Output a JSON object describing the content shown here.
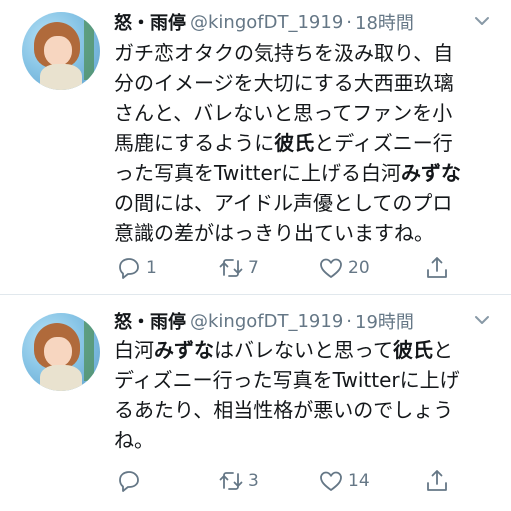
{
  "tweets": [
    {
      "name": "怒・雨停",
      "handle": "@kingofDT_1919",
      "separator": "·",
      "time": "18時間",
      "lines": [
        [
          "ガチ恋オタクの気持ちを汲み取り、自"
        ],
        [
          "分のイメージを大切にする大西亜玖璃"
        ],
        [
          "さんと、バレないと思ってファンを小"
        ],
        [
          "馬鹿にするように",
          "彼氏",
          "とディズニー行"
        ],
        [
          "った写真をTwitterに上げる白河",
          "みずな"
        ],
        [
          "の間には、アイドル声優としてのプロ"
        ],
        [
          "意識の差がはっきり出ていますね。"
        ]
      ],
      "replies": "1",
      "retweets": "7",
      "likes": "20"
    },
    {
      "name": "怒・雨停",
      "handle": "@kingofDT_1919",
      "separator": "·",
      "time": "19時間",
      "lines": [
        [
          "白河",
          "みずな",
          "はバレないと思って",
          "彼氏",
          "と"
        ],
        [
          "ディズニー行った写真をTwitterに上げ"
        ],
        [
          "るあたり、相当性格が悪いのでしょう"
        ],
        [
          "ね。"
        ]
      ],
      "replies": "",
      "retweets": "3",
      "likes": "14"
    }
  ],
  "icons": [
    "chevron-down-icon",
    "reply-icon",
    "retweet-icon",
    "like-icon",
    "share-icon"
  ],
  "colors": {
    "text": "#14171a",
    "secondary": "#657786",
    "divider": "#e1e8ed"
  }
}
